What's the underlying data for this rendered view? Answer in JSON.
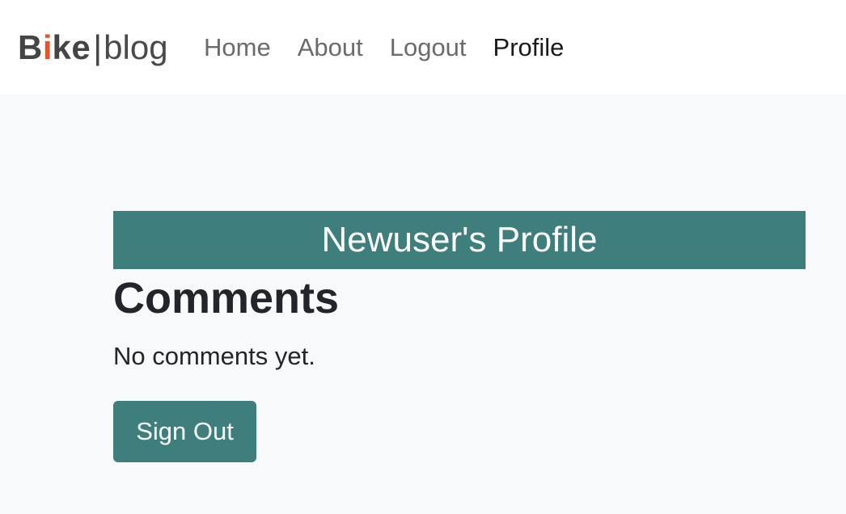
{
  "brand": {
    "part_bold_1": "B",
    "part_accent": "i",
    "part_bold_2": "ke",
    "separator": "|",
    "part_light": "blog"
  },
  "nav": {
    "items": [
      {
        "label": "Home",
        "active": false
      },
      {
        "label": "About",
        "active": false
      },
      {
        "label": "Logout",
        "active": false
      },
      {
        "label": "Profile",
        "active": true
      }
    ]
  },
  "main": {
    "banner_title": "Newuser's Profile",
    "comments_heading": "Comments",
    "empty_message": "No comments yet.",
    "signout_label": "Sign Out"
  },
  "colors": {
    "accent": "#3e7f7e",
    "brand_accent": "#e2542b",
    "page_bg": "#f8f9fa",
    "nav_bg": "#ffffff"
  }
}
